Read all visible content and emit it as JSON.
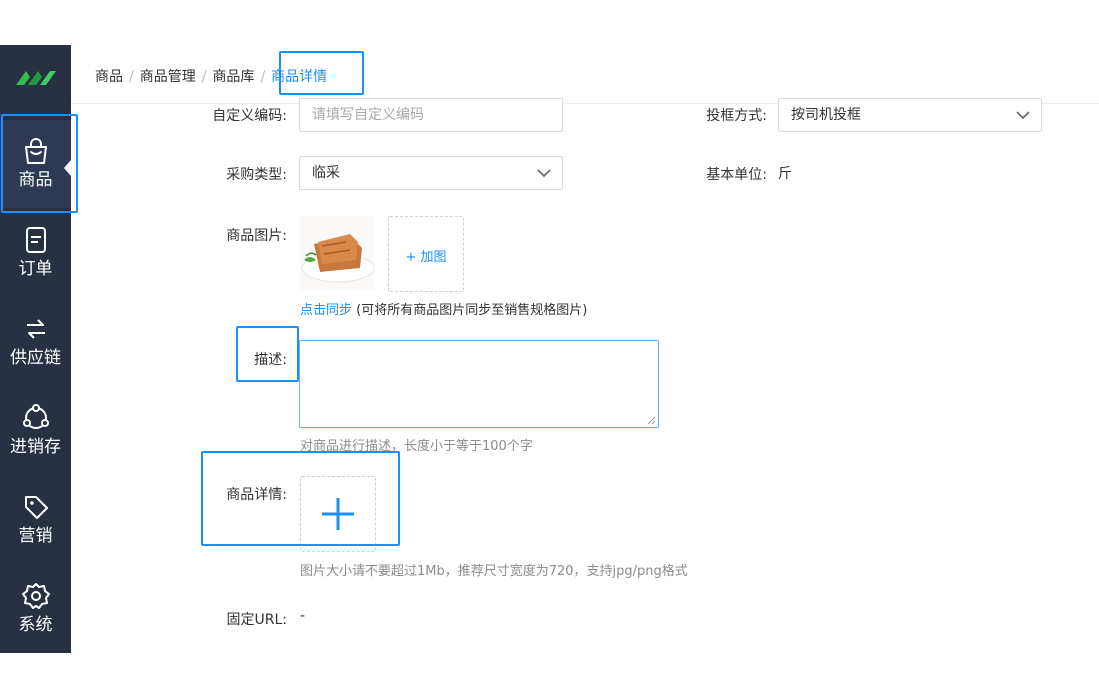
{
  "sidebar": {
    "items": [
      {
        "label": "商品",
        "icon": "shopping-bag-icon"
      },
      {
        "label": "订单",
        "icon": "order-document-icon"
      },
      {
        "label": "供应链",
        "icon": "transfer-arrows-icon"
      },
      {
        "label": "进销存",
        "icon": "inventory-cycle-icon"
      },
      {
        "label": "营销",
        "icon": "tag-icon"
      },
      {
        "label": "系统",
        "icon": "gear-icon"
      }
    ],
    "active": "商品"
  },
  "breadcrumb": {
    "items": [
      "商品",
      "商品管理",
      "商品库",
      "商品详情"
    ],
    "separator": "/"
  },
  "form": {
    "custom_code": {
      "label": "自定义编码:",
      "placeholder": "请填写自定义编码"
    },
    "frame_method": {
      "label": "投框方式:",
      "value": "按司机投框"
    },
    "purchase_type": {
      "label": "采购类型:",
      "value": "临采"
    },
    "base_unit": {
      "label": "基本单位:",
      "value": "斤"
    },
    "product_image": {
      "label": "商品图片:",
      "add_label": "+ 加图",
      "sync_link": "点击同步",
      "sync_note": "(可将所有商品图片同步至销售规格图片)"
    },
    "description": {
      "label": "描述:",
      "hint": "对商品进行描述，长度小于等于100个字"
    },
    "product_detail": {
      "label": "商品详情:",
      "hint": "图片大小请不要超过1Mb，推荐尺寸宽度为720，支持jpg/png格式"
    },
    "fixed_url": {
      "label": "固定URL:",
      "value": "-"
    }
  },
  "colors": {
    "sidebar_bg": "#283044",
    "accent": "#1890ff",
    "highlight_box": "#1890ff"
  }
}
